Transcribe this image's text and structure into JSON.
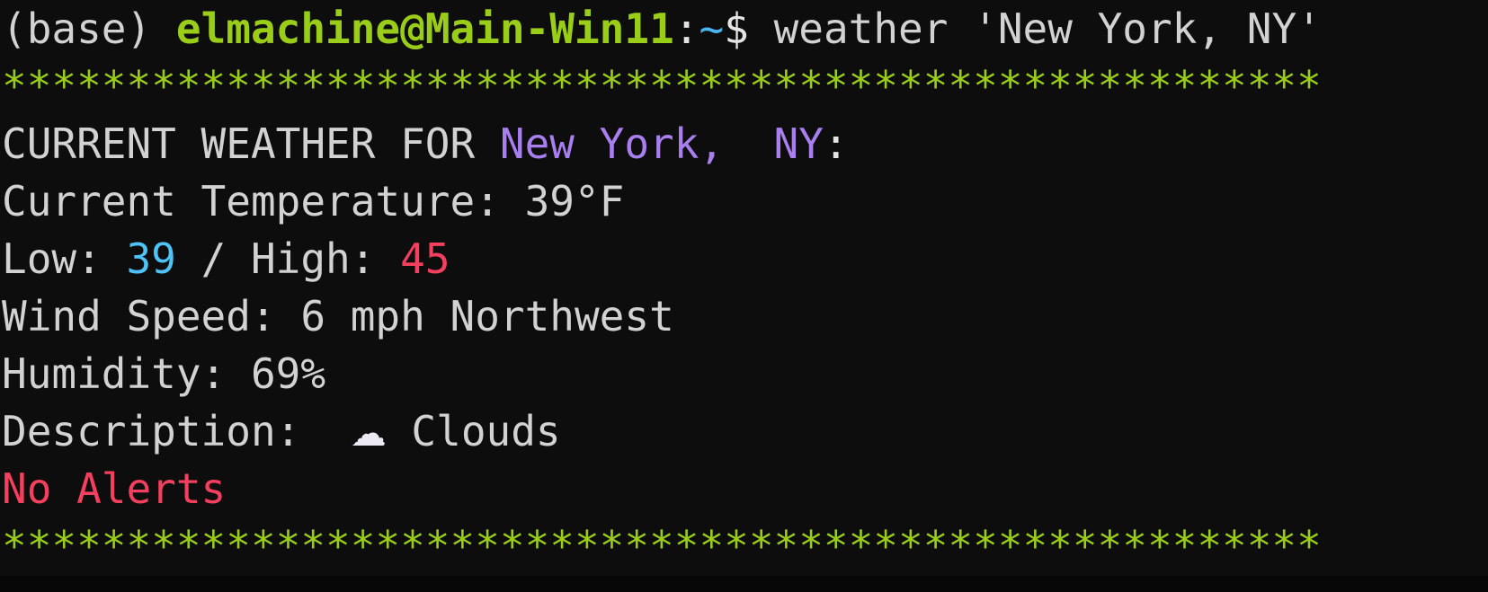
{
  "terminal": {
    "background_color": "#0d0d0d",
    "colors": {
      "prompt_green": "#9ACD18",
      "tilde_cyan": "#49B6F0",
      "low_blue": "#4FC3F7",
      "location_purple": "#A97FF0",
      "alert_pink": "#F43F5E",
      "default_text": "#d6d6d6"
    },
    "prompt_line": {
      "env": "(base)",
      "user_host": "elmachine@Main-Win11",
      "colon": ":",
      "path": "~",
      "sigil": "$",
      "command": " weather 'New York, NY'"
    },
    "divider_top": "*****************************************************",
    "divider_bottom": "*****************************************************",
    "header": {
      "label": "CURRENT WEATHER FOR ",
      "location": "New York,  NY",
      "suffix": ":"
    },
    "rows": {
      "temperature_label": "Current Temperature: ",
      "temperature_value": "39°F",
      "low_label": "Low: ",
      "low_value": "39",
      "separator": " / ",
      "high_label": "High: ",
      "high_value": "45",
      "wind_label": "Wind Speed: ",
      "wind_value": "6 mph Northwest",
      "humidity_label": "Humidity: ",
      "humidity_value": "69%",
      "description_label": "Description:  ",
      "description_icon": "☁",
      "description_value": " Clouds",
      "alerts": "No Alerts"
    }
  }
}
